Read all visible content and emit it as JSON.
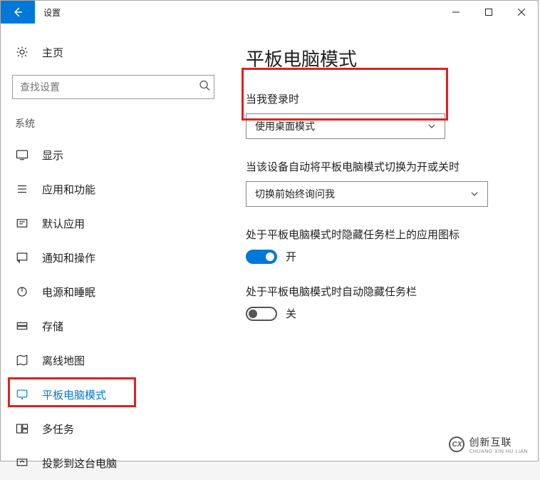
{
  "titlebar": {
    "title": "设置"
  },
  "sidebar": {
    "home": "主页",
    "search_placeholder": "查找设置",
    "section": "系统",
    "items": [
      {
        "label": "显示"
      },
      {
        "label": "应用和功能"
      },
      {
        "label": "默认应用"
      },
      {
        "label": "通知和操作"
      },
      {
        "label": "电源和睡眠"
      },
      {
        "label": "存储"
      },
      {
        "label": "离线地图"
      },
      {
        "label": "平板电脑模式"
      },
      {
        "label": "多任务"
      },
      {
        "label": "投影到这台电脑"
      }
    ]
  },
  "main": {
    "heading": "平板电脑模式",
    "group1": {
      "label": "当我登录时",
      "value": "使用桌面模式"
    },
    "group2": {
      "label": "当该设备自动将平板电脑模式切换为开或关时",
      "value": "切换前始终询问我"
    },
    "group3": {
      "label": "处于平板电脑模式时隐藏任务栏上的应用图标",
      "state": "开"
    },
    "group4": {
      "label": "处于平板电脑模式时自动隐藏任务栏",
      "state": "关"
    }
  },
  "watermark": {
    "cn": "创新互联",
    "en": "CHUANG XIN HU LIAN"
  }
}
